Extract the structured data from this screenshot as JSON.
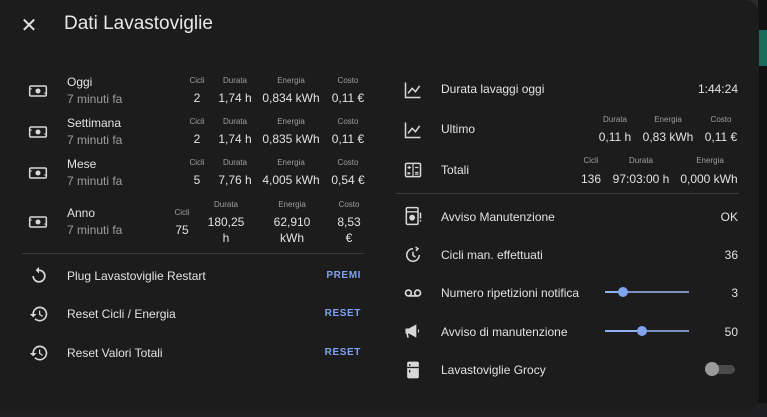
{
  "dialog": {
    "title": "Dati Lavastoviglie",
    "close_icon": "close-icon"
  },
  "left": {
    "periods": [
      {
        "name": "Oggi",
        "when": "7 minuti fa",
        "icon": "cash-icon",
        "cols": [
          {
            "label": "Cicli",
            "value": "2"
          },
          {
            "label": "Durata",
            "value": "1,74 h"
          },
          {
            "label": "Energia",
            "value": "0,834 kWh"
          },
          {
            "label": "Costo",
            "value": "0,11 €"
          }
        ]
      },
      {
        "name": "Settimana",
        "when": "7 minuti fa",
        "icon": "cash-icon",
        "cols": [
          {
            "label": "Cicli",
            "value": "2"
          },
          {
            "label": "Durata",
            "value": "1,74 h"
          },
          {
            "label": "Energia",
            "value": "0,835 kWh"
          },
          {
            "label": "Costo",
            "value": "0,11 €"
          }
        ]
      },
      {
        "name": "Mese",
        "when": "7 minuti fa",
        "icon": "cash-icon",
        "cols": [
          {
            "label": "Cicli",
            "value": "5"
          },
          {
            "label": "Durata",
            "value": "7,76 h"
          },
          {
            "label": "Energia",
            "value": "4,005 kWh"
          },
          {
            "label": "Costo",
            "value": "0,54 €"
          }
        ]
      },
      {
        "name": "Anno",
        "when": "7 minuti fa",
        "icon": "cash-icon",
        "cols": [
          {
            "label": "Cicli",
            "value": "75"
          },
          {
            "label": "Durata",
            "value": "180,25",
            "value2": "h"
          },
          {
            "label": "Energia",
            "value": "62,910",
            "value2": "kWh"
          },
          {
            "label": "Costo",
            "value": "8,53",
            "value2": "€"
          }
        ]
      }
    ],
    "actions": [
      {
        "label": "Plug Lavastoviglie Restart",
        "button": "PREMI",
        "icon": "restart-icon"
      },
      {
        "label": "Reset Cicli / Energia",
        "button": "RESET",
        "icon": "history-icon"
      },
      {
        "label": "Reset Valori Totali",
        "button": "RESET",
        "icon": "history-icon"
      }
    ]
  },
  "right": {
    "durata_oggi": {
      "label": "Durata lavaggi oggi",
      "value": "1:44:24",
      "icon": "chart-line-icon"
    },
    "ultimo": {
      "label": "Ultimo",
      "icon": "chart-line-icon",
      "cols": [
        {
          "label": "Durata",
          "value": "0,11 h"
        },
        {
          "label": "Energia",
          "value": "0,83 kWh"
        },
        {
          "label": "Costo",
          "value": "0,11 €"
        }
      ]
    },
    "totali": {
      "label": "Totali",
      "icon": "sigma-icon",
      "cols": [
        {
          "label": "Cicli",
          "value": "136"
        },
        {
          "label": "Durata",
          "value": "97:03:00 h"
        },
        {
          "label": "Energia",
          "value": "0,000 kWh"
        }
      ]
    },
    "avviso_manutenzione": {
      "label": "Avviso Manutenzione",
      "value": "OK",
      "icon": "dishwasher-alert-icon"
    },
    "cicli_man": {
      "label": "Cicli man. effettuati",
      "value": "36",
      "icon": "timer-refresh-icon"
    },
    "ripetizioni": {
      "label": "Numero ripetizioni notifica",
      "value": "3",
      "icon": "voicemail-icon",
      "fraction": 0.22
    },
    "avviso_di_manutenzione": {
      "label": "Avviso di manutenzione",
      "value": "50",
      "icon": "bullhorn-icon",
      "fraction": 0.44
    },
    "grocy": {
      "label": "Lavastoviglie Grocy",
      "icon": "fridge-icon",
      "on": false
    },
    "colors": {
      "accent": "#7da2f2",
      "background": "#1c1c1c"
    }
  }
}
